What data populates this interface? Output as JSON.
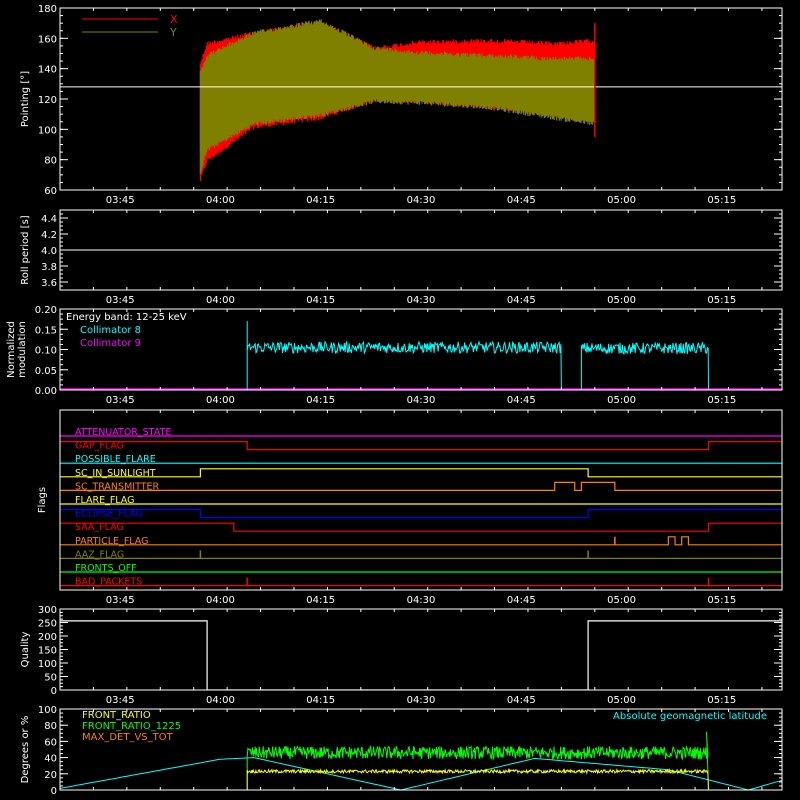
{
  "time_axis": {
    "ticks": [
      "03:45",
      "04:00",
      "04:15",
      "04:30",
      "04:45",
      "05:00",
      "05:15"
    ],
    "tick_minutes": [
      225,
      240,
      255,
      270,
      285,
      300,
      315
    ],
    "range_minutes": [
      216,
      324
    ]
  },
  "chart_data": [
    {
      "type": "line",
      "ylabel": "Pointing [°]",
      "ylim": [
        60,
        180
      ],
      "yticks": [
        60,
        80,
        100,
        120,
        140,
        160,
        180
      ],
      "legend": {
        "placement": "top-left",
        "entries": [
          "X",
          "Y"
        ]
      },
      "series": [
        {
          "name": "X",
          "color": "#ff0000",
          "x": [
            "03:57",
            "03:58",
            "04:05",
            "04:15",
            "04:23",
            "04:30",
            "04:40",
            "04:50",
            "04:56"
          ],
          "upper": [
            145,
            158,
            165,
            172,
            155,
            159,
            160,
            158,
            160
          ],
          "lower": [
            65,
            78,
            100,
            106,
            118,
            117,
            113,
            109,
            104
          ]
        },
        {
          "name": "Y",
          "color": "#808000",
          "x": [
            "03:57",
            "03:58",
            "04:05",
            "04:15",
            "04:23",
            "04:30",
            "04:40",
            "04:50",
            "04:56"
          ],
          "upper": [
            140,
            150,
            165,
            173,
            155,
            152,
            150,
            148,
            148
          ],
          "lower": [
            70,
            85,
            102,
            108,
            117,
            116,
            113,
            106,
            102
          ]
        }
      ],
      "reference_line": 128
    },
    {
      "type": "line",
      "ylabel": "Roll period [s]",
      "ylim": [
        3.5,
        4.5
      ],
      "yticks": [
        3.6,
        3.8,
        4.0,
        4.2,
        4.4
      ],
      "yticklabels": [
        "3.6",
        "3.8",
        "4.0",
        "4.2",
        "4.4"
      ],
      "value": 4.0
    },
    {
      "type": "line",
      "ylabel_lines": [
        "Normalized",
        "modulation"
      ],
      "ylim": [
        0,
        0.2
      ],
      "yticks": [
        0,
        0.05,
        0.1,
        0.15,
        0.2
      ],
      "yticklabels": [
        "0.00",
        "0.05",
        "0.10",
        "0.15",
        "0.20"
      ],
      "annotation": "Energy band: 12-25 keV",
      "series": [
        {
          "name": "Collimator 8",
          "color": "#00ffff",
          "segments": [
            {
              "from": "04:04",
              "to": "04:51",
              "level": 0.105,
              "spike": 0.17
            },
            {
              "from": "04:54",
              "to": "05:13",
              "level": 0.103
            }
          ]
        },
        {
          "name": "Collimator 9",
          "color": "#ff00ff",
          "level": 0
        }
      ]
    },
    {
      "type": "line",
      "ylabel": "Flags",
      "flags": [
        {
          "name": "ATTENUATOR_STATE",
          "color": "#ff00ff",
          "highs": []
        },
        {
          "name": "GAP_FLAG",
          "color": "#ff0000",
          "highs": [
            [
              "03:36",
              "04:04"
            ],
            [
              "05:13",
              "05:24"
            ]
          ]
        },
        {
          "name": "POSSIBLE_FLARE",
          "color": "#00ffff",
          "highs": []
        },
        {
          "name": "SC_IN_SUNLIGHT",
          "color": "#ffff00",
          "highs": [
            [
              "03:57",
              "04:55"
            ]
          ]
        },
        {
          "name": "SC_TRANSMITTER",
          "color": "#ff8000",
          "highs": [
            [
              "04:50",
              "04:53"
            ],
            [
              "04:54",
              "04:59"
            ]
          ]
        },
        {
          "name": "FLARE_FLAG",
          "color": "#ffff00",
          "highs": []
        },
        {
          "name": "ECLIPSE_FLAG",
          "color": "#0000ff",
          "highs": [
            [
              "03:36",
              "03:57"
            ],
            [
              "04:55",
              "05:24"
            ]
          ]
        },
        {
          "name": "SAA_FLAG",
          "color": "#ff0000",
          "highs": [
            [
              "03:36",
              "04:02"
            ],
            [
              "05:13",
              "05:24"
            ]
          ]
        },
        {
          "name": "PARTICLE_FLAG",
          "color": "#ff8000",
          "highs": [
            [
              "05:07",
              "05:08"
            ],
            [
              "05:09",
              "05:10"
            ]
          ],
          "spikes": [
            "04:59"
          ]
        },
        {
          "name": "AAZ_FLAG",
          "color": "#808000",
          "highs": [],
          "spikes": [
            "03:57",
            "04:55"
          ]
        },
        {
          "name": "FRONTS_OFF",
          "color": "#00ff00",
          "highs": []
        },
        {
          "name": "BAD_PACKETS",
          "color": "#ff0000",
          "highs": [],
          "spikes": [
            "04:04",
            "05:13"
          ]
        }
      ]
    },
    {
      "type": "line",
      "ylabel": "Quality",
      "ylim": [
        0,
        300
      ],
      "yticks": [
        0,
        50,
        100,
        150,
        200,
        250,
        300
      ],
      "yticklabels": [
        "0",
        "50",
        "100",
        "150",
        "200",
        "250",
        "300"
      ],
      "x": [
        "03:36",
        "03:58",
        "03:58",
        "04:55",
        "04:55",
        "05:24"
      ],
      "y": [
        256,
        256,
        0,
        0,
        256,
        256
      ]
    },
    {
      "type": "line",
      "ylabel": "Degrees or %",
      "ylim": [
        0,
        100
      ],
      "yticks": [
        0,
        20,
        40,
        60,
        80,
        100
      ],
      "yticklabels": [
        "0",
        "20",
        "40",
        "60",
        "80",
        "100"
      ],
      "series": [
        {
          "name": "FRONT_RATIO",
          "color": "#ffff00",
          "from": "04:04",
          "to": "05:13",
          "level": 23
        },
        {
          "name": "FRONT_RATIO_1225",
          "color": "#00ff00",
          "from": "04:04",
          "to": "05:13",
          "level": 46
        },
        {
          "name": "MAX_DET_VS_TOT",
          "color": "#ff8000"
        },
        {
          "name": "Absolute geomagnetic latitude",
          "color": "#00ffff",
          "x": [
            "03:36",
            "04:00",
            "04:05",
            "04:27",
            "04:47",
            "05:07",
            "05:19",
            "05:24"
          ],
          "y": [
            2,
            38,
            40,
            0,
            39,
            25,
            0,
            12
          ]
        }
      ]
    }
  ]
}
